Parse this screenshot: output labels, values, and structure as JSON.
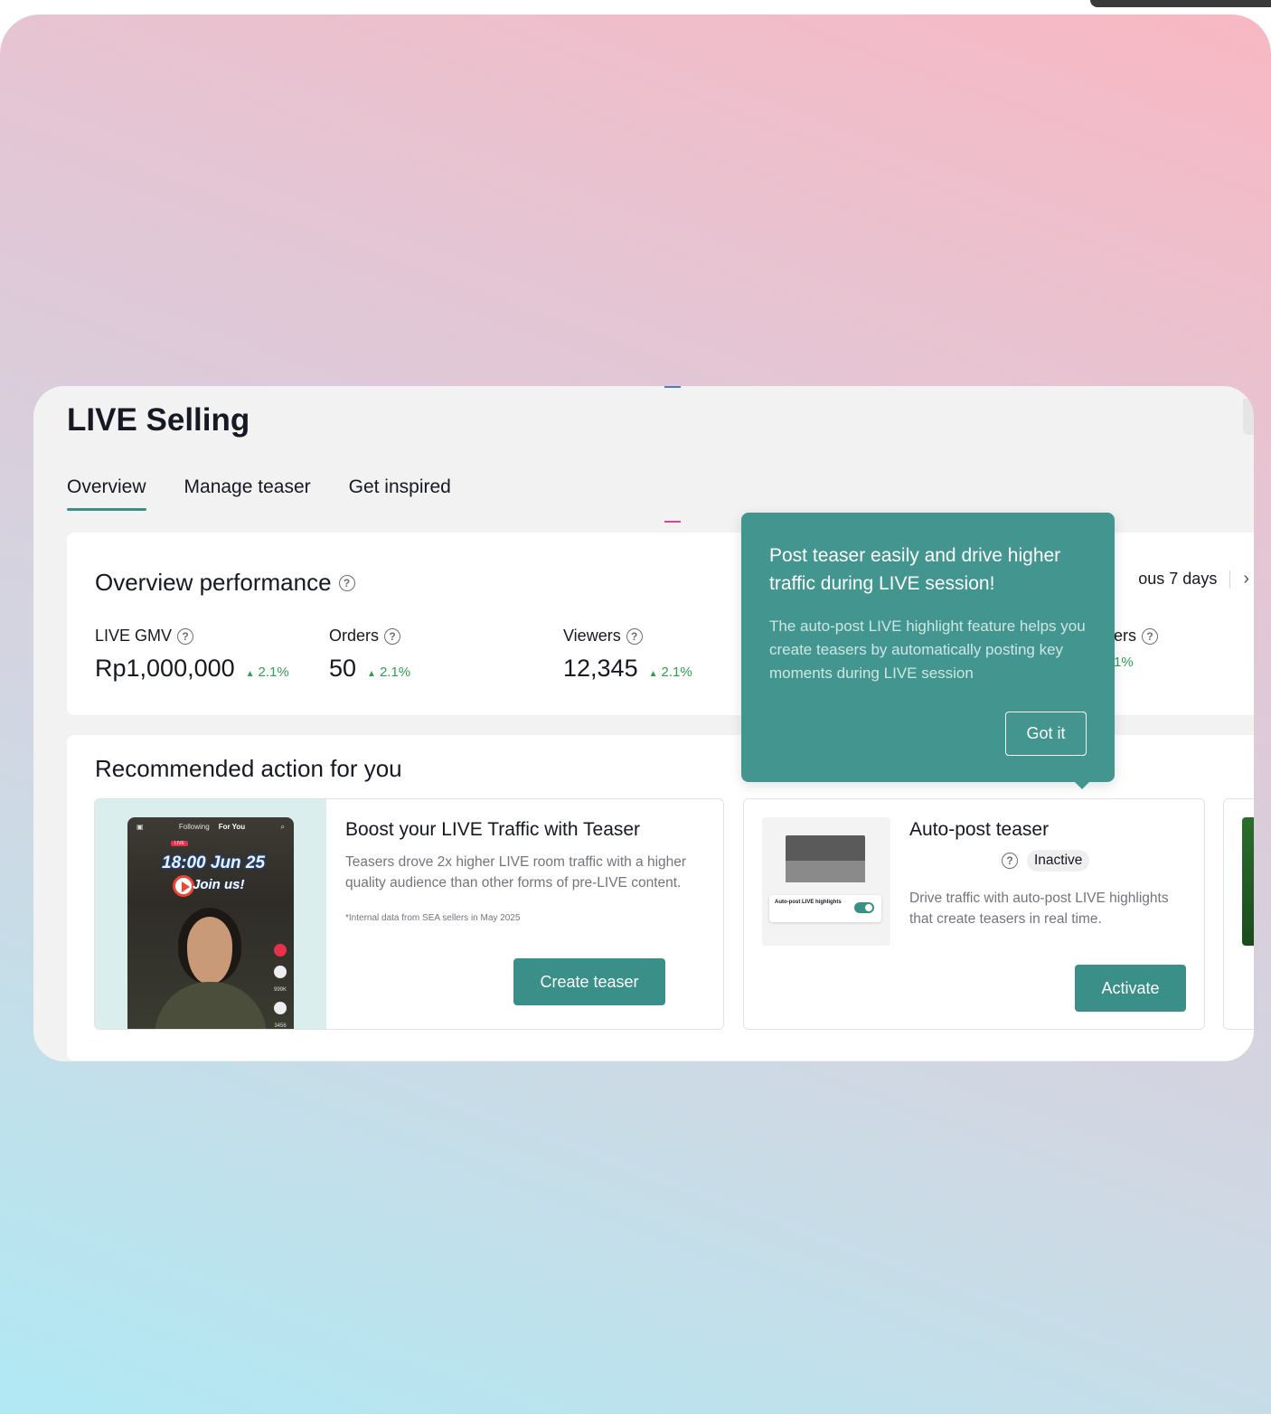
{
  "page": {
    "title": "LIVE Selling"
  },
  "tabs": [
    {
      "label": "Overview",
      "active": true
    },
    {
      "label": "Manage teaser",
      "active": false
    },
    {
      "label": "Get inspired",
      "active": false
    }
  ],
  "performance": {
    "title": "Overview performance",
    "period_label": "ous 7 days",
    "metrics": [
      {
        "label": "LIVE GMV",
        "value": "Rp1,000,000",
        "delta": "2.1%"
      },
      {
        "label": "Orders",
        "value": "50",
        "delta": "2.1%"
      },
      {
        "label": "Viewers",
        "value": "12,345",
        "delta": "2.1%"
      },
      {
        "label": "ers",
        "value": "",
        "delta": "1%"
      }
    ]
  },
  "recommended": {
    "title": "Recommended action for you",
    "boost": {
      "title": "Boost your LIVE Traffic with Teaser",
      "description": "Teasers drove 2x higher LIVE room traffic with a higher quality audience than other forms of pre-LIVE content.",
      "footnote": "*Internal data from SEA sellers in May 2025",
      "button": "Create teaser",
      "preview": {
        "tab_following": "Following",
        "tab_foryou": "For You",
        "live_tag": "LIVE",
        "date_text": "18:00 Jun 25",
        "join_text": "Join us!",
        "likes": "999K",
        "comments": "3456"
      }
    },
    "autopost": {
      "title": "Auto-post teaser",
      "status": "Inactive",
      "description": "Drive traffic with auto-post LIVE highlights that create teasers in real time.",
      "button": "Activate",
      "preview_label": "Auto-post LIVE highlights"
    }
  },
  "tooltip": {
    "title": "Post teaser easily and drive higher traffic during LIVE session!",
    "text": "The auto-post LIVE highlight feature helps you create teasers by automatically posting key moments during LIVE session",
    "button": "Got it"
  },
  "colors": {
    "accent": "#3a8f88",
    "tooltip_bg": "#42968f",
    "positive": "#2ea04f"
  },
  "icons": {
    "help": "help-circle-icon",
    "next": "chevron-right-icon",
    "trend": "arrow-up-icon"
  }
}
